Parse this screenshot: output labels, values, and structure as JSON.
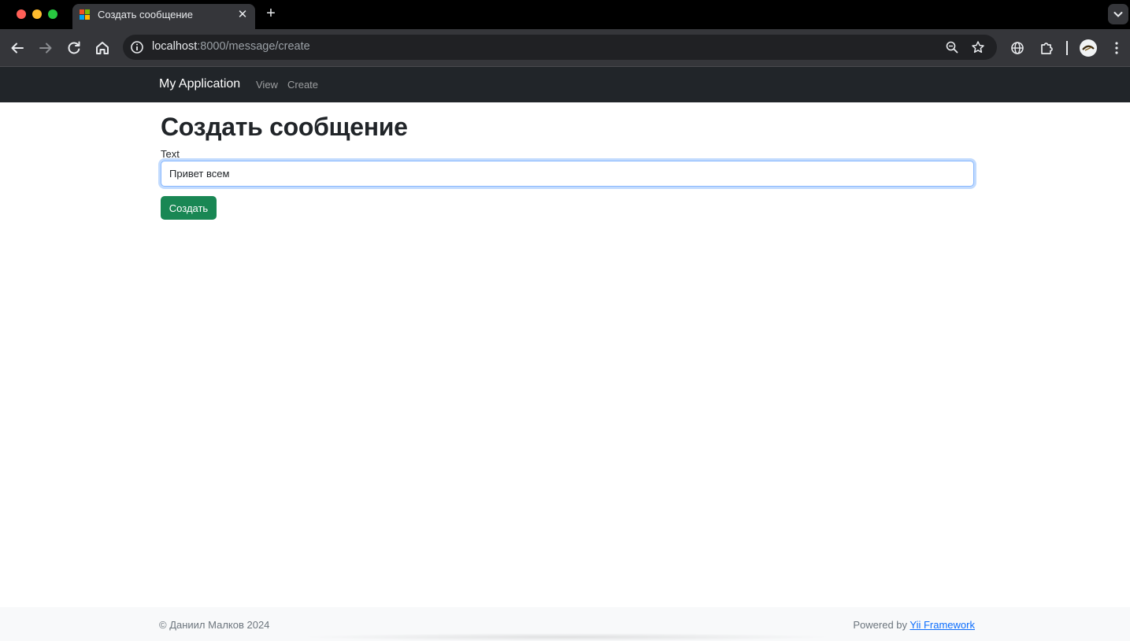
{
  "browser": {
    "tab_title": "Создать сообщение",
    "url_host": "localhost",
    "url_rest": ":8000/message/create"
  },
  "navbar": {
    "brand": "My Application",
    "links": [
      "View",
      "Create"
    ]
  },
  "main": {
    "title": "Создать сообщение",
    "text_label": "Text",
    "text_value": "Привет всем",
    "submit_label": "Создать"
  },
  "footer": {
    "copyright": "© Даниил Малков 2024",
    "powered_prefix": "Powered by",
    "powered_link": "Yii Framework"
  },
  "colors": {
    "navbar_bg": "#212529",
    "submit_bg": "#198754",
    "link": "#0d6efd",
    "input_focus_border": "#86b7fe"
  }
}
